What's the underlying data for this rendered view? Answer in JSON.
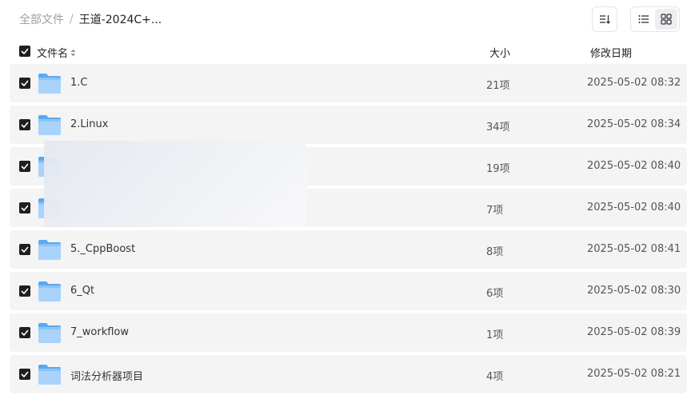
{
  "breadcrumb": {
    "root": "全部文件",
    "separator": "/",
    "current": "王道-2024C+..."
  },
  "toolbar": {
    "sort_icon": "sort-lines-icon",
    "view_list_icon": "list-view-icon",
    "view_grid_icon": "grid-view-icon",
    "active_view": "grid"
  },
  "table": {
    "columns": {
      "name": "文件名",
      "size": "大小",
      "date": "修改日期"
    },
    "rows": [
      {
        "name": "1.C",
        "size": "21项",
        "date": "2025-05-02 08:32"
      },
      {
        "name": "2.Linux",
        "size": "34项",
        "date": "2025-05-02 08:34"
      },
      {
        "name": "",
        "size": "19项",
        "date": "2025-05-02 08:40"
      },
      {
        "name": "",
        "size": "7项",
        "date": "2025-05-02 08:40"
      },
      {
        "name": "5._CppBoost",
        "size": "8项",
        "date": "2025-05-02 08:41"
      },
      {
        "name": "6_Qt",
        "size": "6项",
        "date": "2025-05-02 08:30"
      },
      {
        "name": "7_workflow",
        "size": "1项",
        "date": "2025-05-02 08:39"
      },
      {
        "name": "词法分析器项目",
        "size": "4项",
        "date": "2025-05-02 08:21"
      }
    ]
  },
  "colors": {
    "checkbox": "#1f1f1f",
    "row_bg": "#f4f4f5",
    "folder_light": "#a9d3fb",
    "folder_dark": "#5aa9f2"
  }
}
